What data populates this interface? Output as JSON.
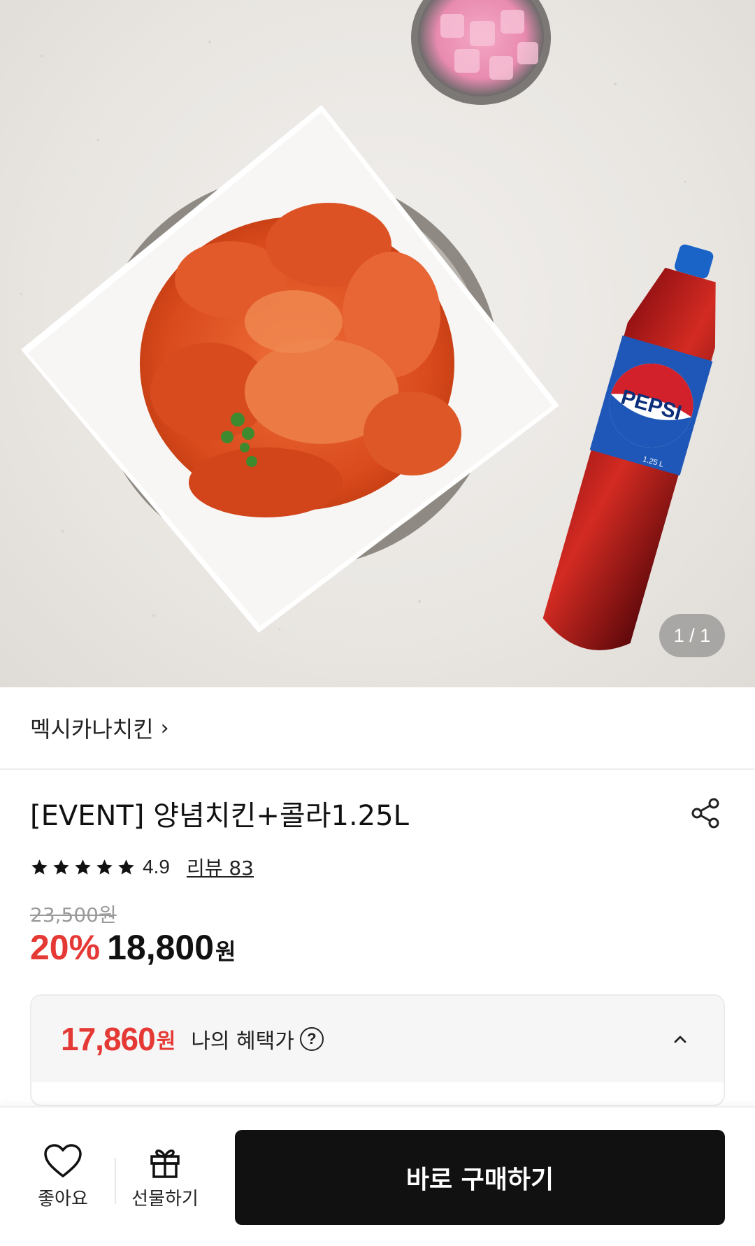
{
  "hero": {
    "page_indicator": "1 / 1",
    "bottle_logo_text": "PEPSI",
    "bottle_size_text": "1.25 L"
  },
  "brand": {
    "name": "멕시카나치킨",
    "chevron": "›"
  },
  "product": {
    "title": "[EVENT] 양념치킨+콜라1.25L",
    "rating": "4.9",
    "rating_stars": 5,
    "review_label": "리뷰 83",
    "original_price": "23,500원",
    "discount": "20%",
    "sale_price": "18,800",
    "currency": "원"
  },
  "benefit": {
    "price": "17,860",
    "currency": "원",
    "label": "나의 혜택가",
    "help_glyph": "?"
  },
  "bottom_bar": {
    "like_label": "좋아요",
    "gift_label": "선물하기",
    "buy_label": "바로 구매하기"
  },
  "icons": {
    "share": "share-icon",
    "star": "star-icon",
    "help": "question-circle-icon",
    "caret": "chevron-up-icon",
    "like": "heart-icon",
    "gift": "gift-icon"
  },
  "colors": {
    "accent_red": "#e53935",
    "buy_button": "#111111",
    "strike_price": "#9a9a9a",
    "benefit_bg": "#f6f6f6"
  }
}
